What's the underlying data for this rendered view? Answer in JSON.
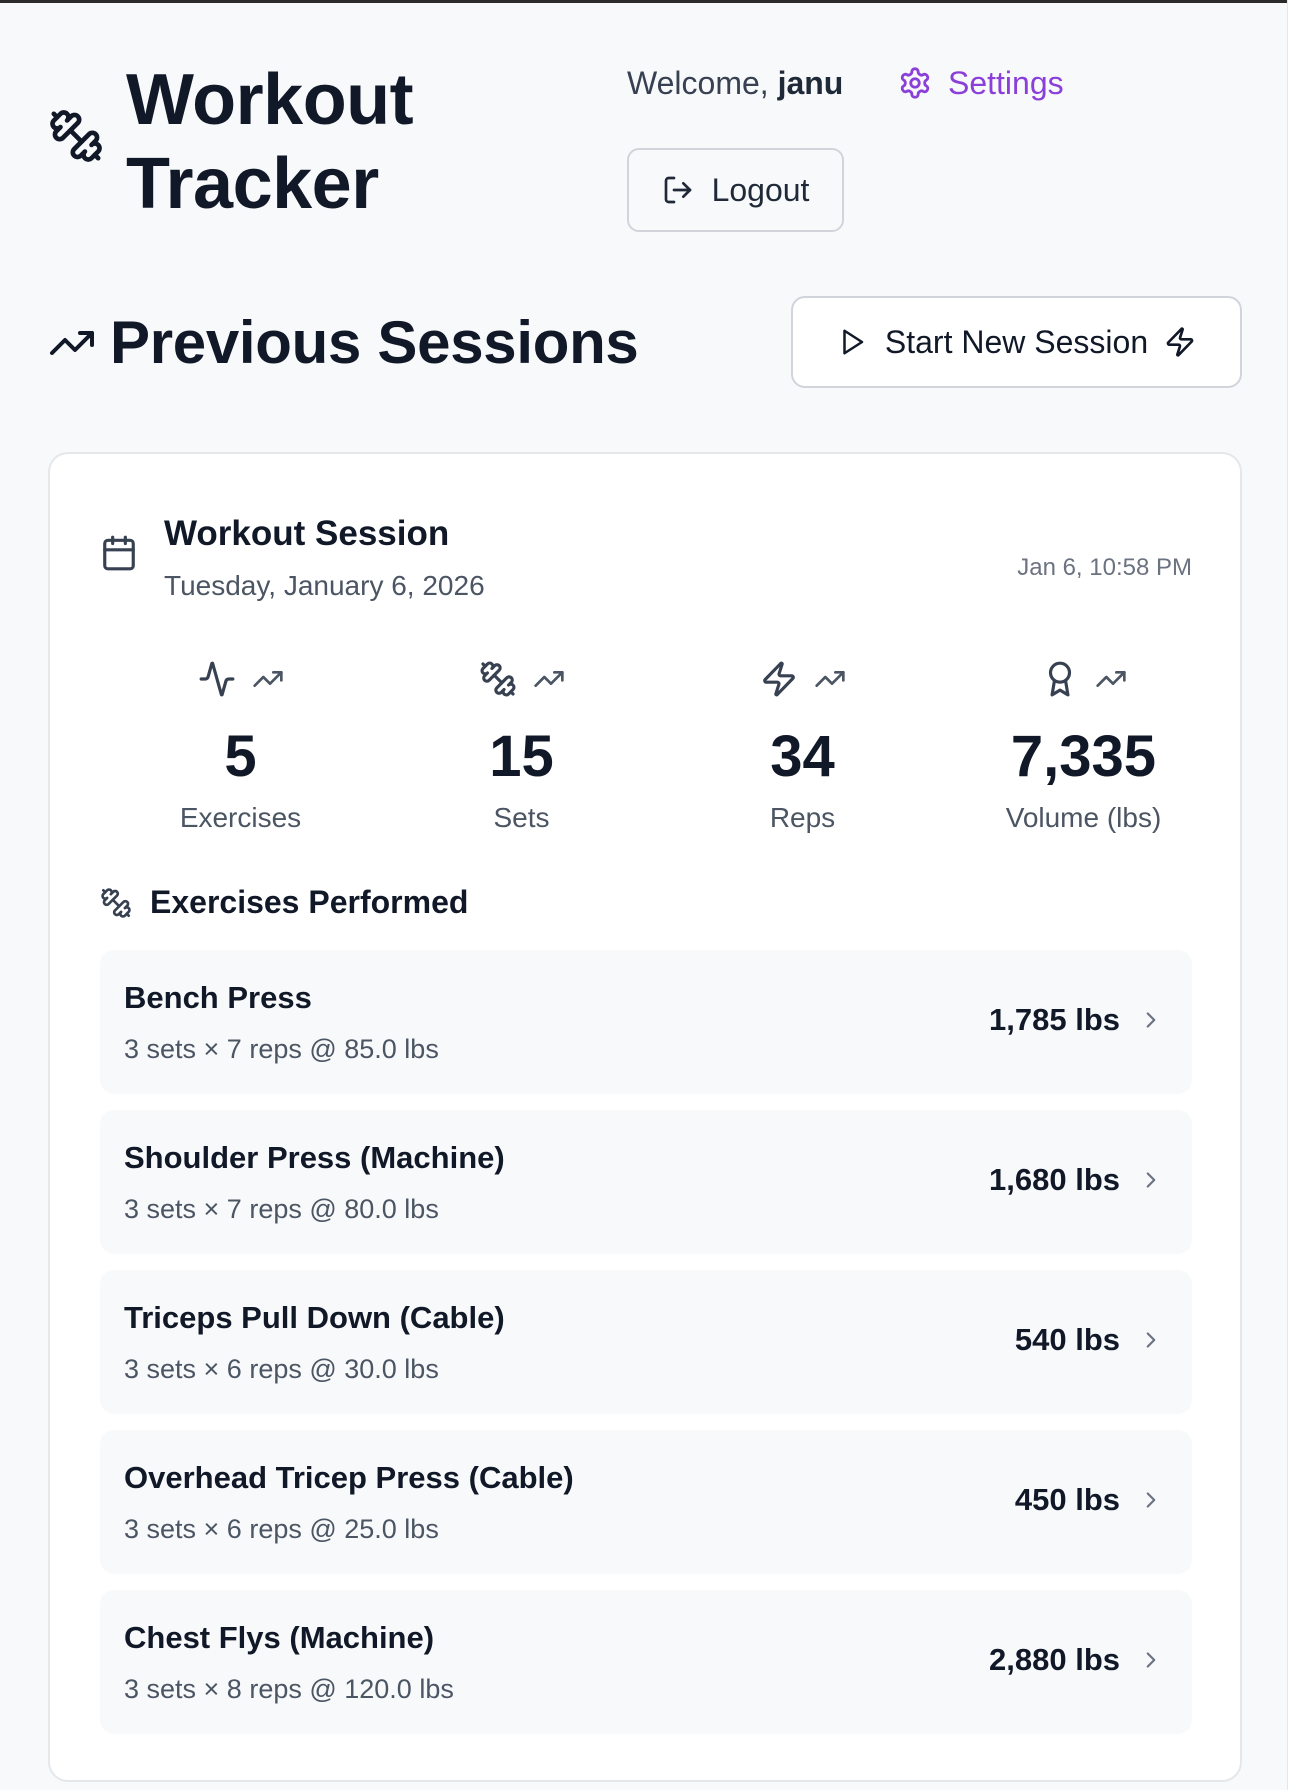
{
  "app": {
    "title_line1": "Workout",
    "title_line2": "Tracker",
    "logo_icon": "dumbbell-icon"
  },
  "header": {
    "welcome_prefix": "Welcome, ",
    "username": "janu",
    "settings_label": "Settings",
    "logout_label": "Logout"
  },
  "section": {
    "title": "Previous Sessions",
    "start_button_label": "Start New Session"
  },
  "session": {
    "title": "Workout Session",
    "date": "Tuesday, January 6, 2026",
    "timestamp": "Jan 6, 10:58 PM",
    "stats": [
      {
        "value": "5",
        "label": "Exercises",
        "icon": "activity-icon"
      },
      {
        "value": "15",
        "label": "Sets",
        "icon": "dumbbell-icon"
      },
      {
        "value": "34",
        "label": "Reps",
        "icon": "zap-icon"
      },
      {
        "value": "7,335",
        "label": "Volume (lbs)",
        "icon": "award-icon"
      }
    ],
    "exercises_header": "Exercises Performed",
    "exercises": [
      {
        "name": "Bench Press",
        "detail": "3 sets × 7 reps @ 85.0 lbs",
        "volume": "1,785 lbs"
      },
      {
        "name": "Shoulder Press (Machine)",
        "detail": "3 sets × 7 reps @ 80.0 lbs",
        "volume": "1,680 lbs"
      },
      {
        "name": "Triceps Pull Down (Cable)",
        "detail": "3 sets × 6 reps @ 30.0 lbs",
        "volume": "540 lbs"
      },
      {
        "name": "Overhead Tricep Press (Cable)",
        "detail": "3 sets × 6 reps @ 25.0 lbs",
        "volume": "450 lbs"
      },
      {
        "name": "Chest Flys (Machine)",
        "detail": "3 sets × 8 reps @ 120.0 lbs",
        "volume": "2,880 lbs"
      }
    ]
  },
  "colors": {
    "accent": "#8b3fd9",
    "text": "#111827",
    "muted": "#4b5563",
    "background": "#f8f9fb"
  }
}
